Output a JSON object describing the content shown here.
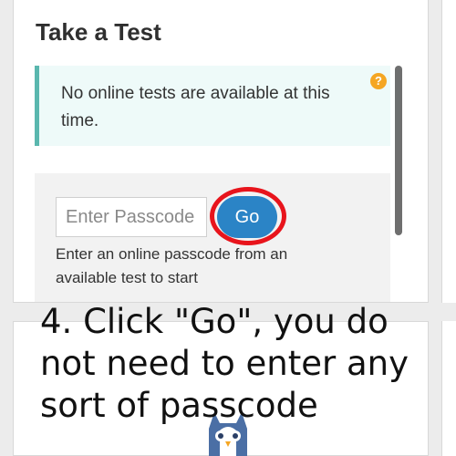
{
  "panel": {
    "title": "Take a Test",
    "alert_message": "No online tests are available at this time.",
    "help_icon_glyph": "?"
  },
  "passcode": {
    "placeholder": "Enter Passcode",
    "value": "",
    "go_label": "Go",
    "help_text": "Enter an online passcode from an available test to start"
  },
  "caption": "4. Click \"Go\", you do not need to enter any sort of passcode",
  "colors": {
    "accent_teal": "#5ab7ae",
    "go_button": "#2b84c6",
    "highlight_ring": "#e8141c",
    "help_icon": "#f5a623"
  }
}
